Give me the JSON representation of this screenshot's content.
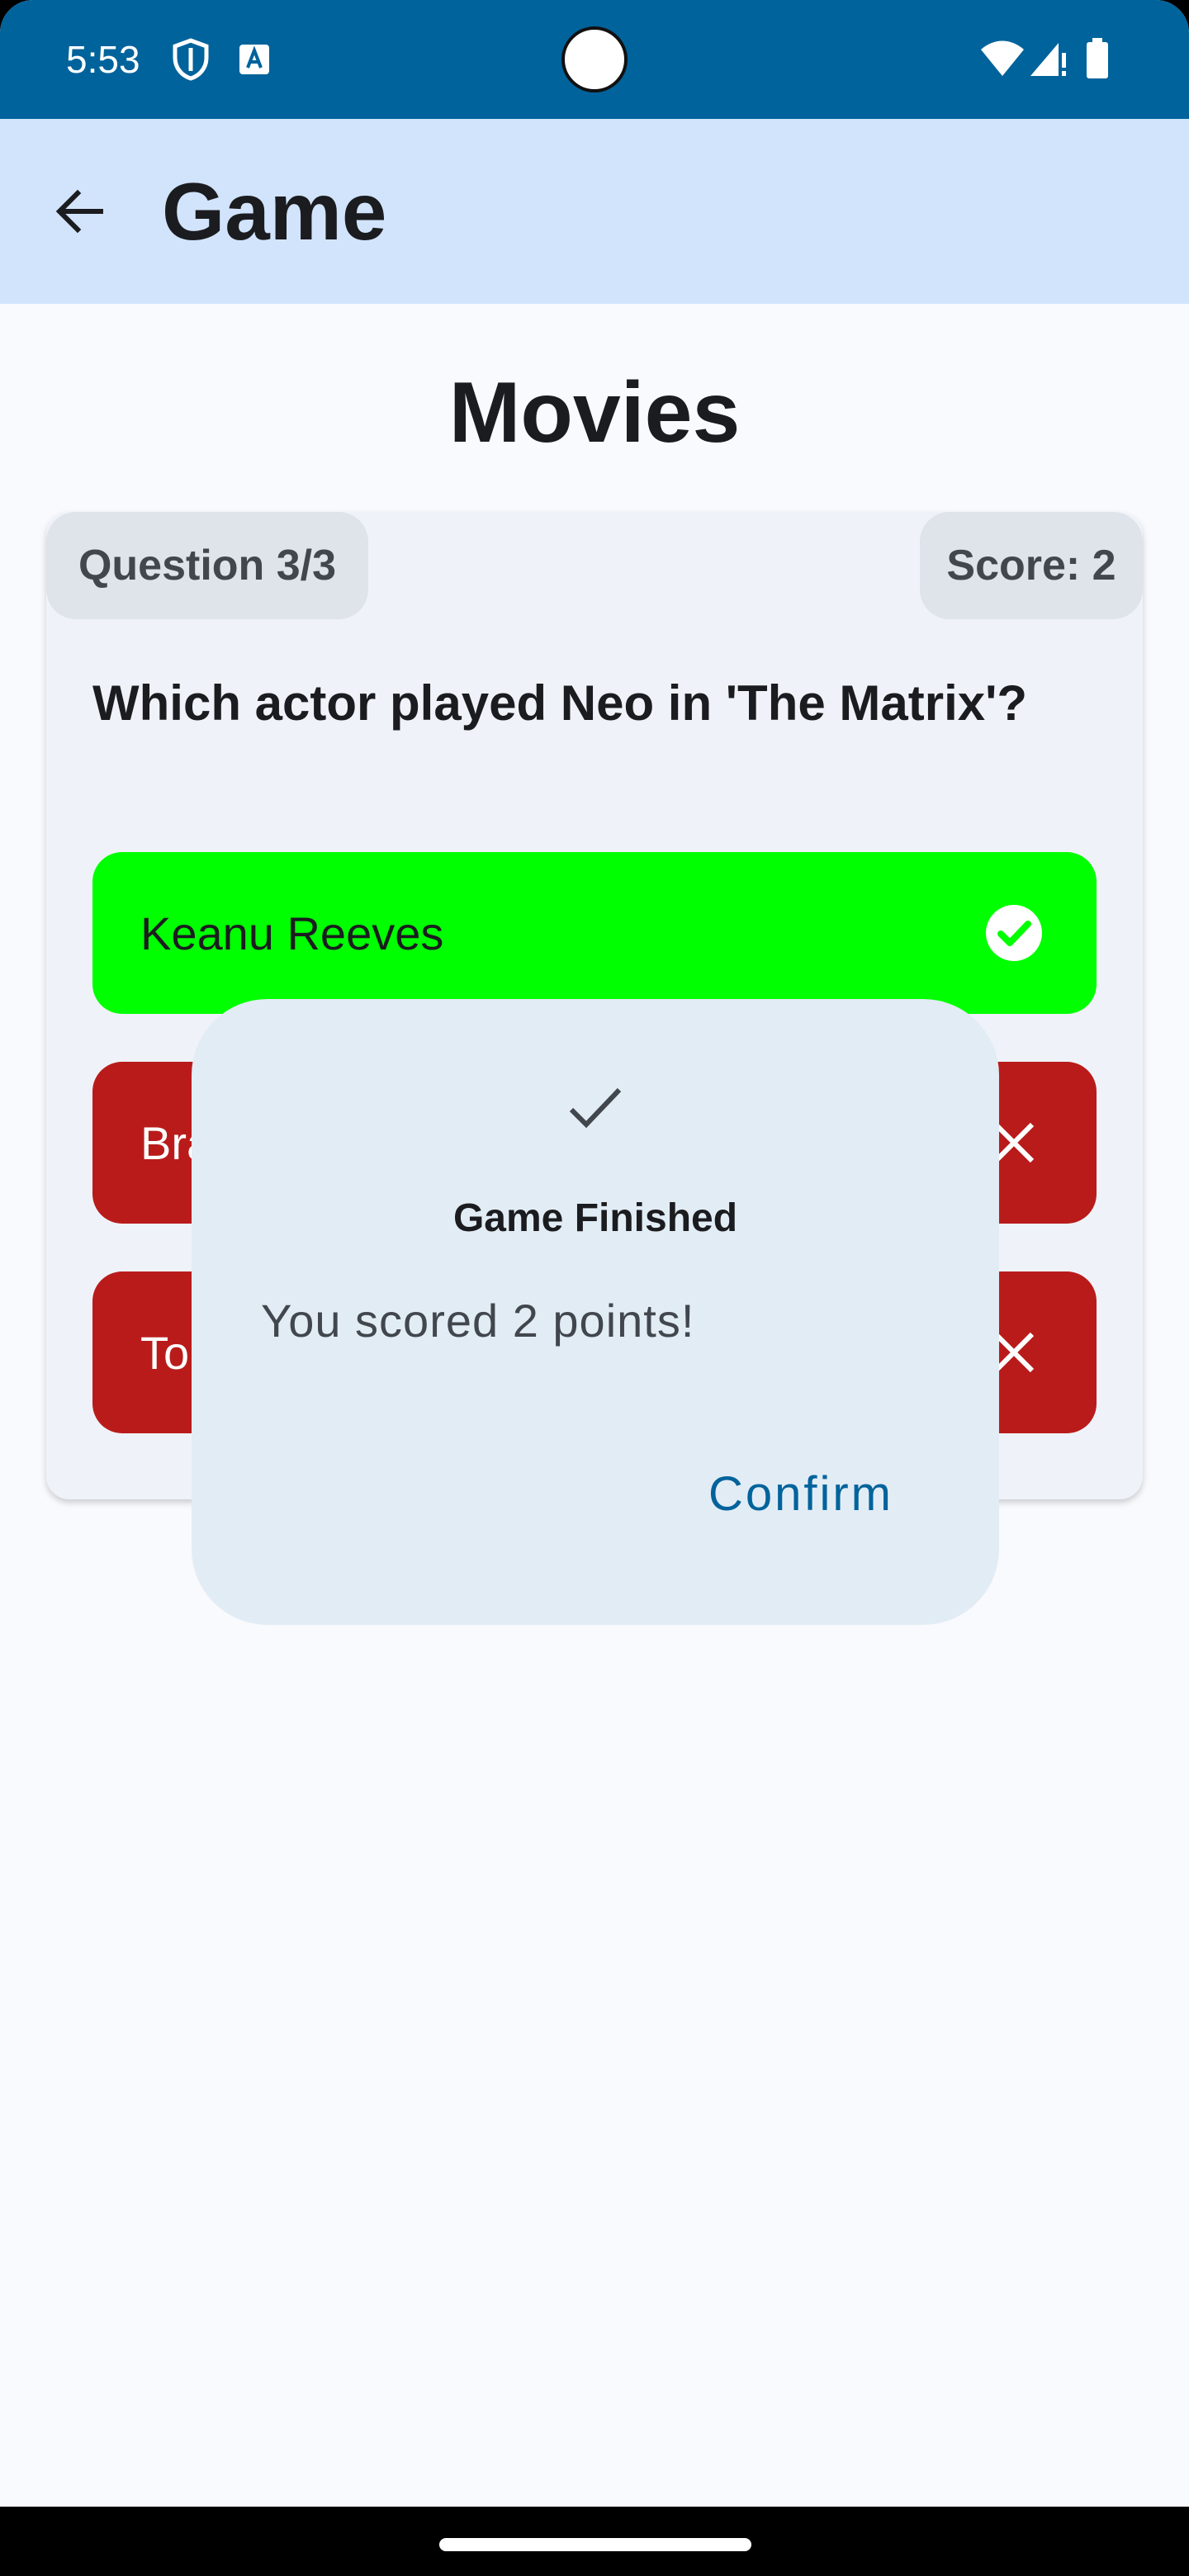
{
  "status_bar": {
    "time": "5:53",
    "icons": [
      "shield-icon",
      "keyboard-a-icon",
      "wifi-icon",
      "signal-icon",
      "battery-icon"
    ]
  },
  "app_bar": {
    "title": "Game",
    "back_icon": "arrow-back-icon"
  },
  "game": {
    "category": "Movies",
    "question_counter": "Question 3/3",
    "score": "Score: 2",
    "question": "Which actor played Neo in 'The Matrix'?",
    "answers": [
      {
        "label": "Keanu Reeves",
        "state": "correct",
        "icon": "check-circle-icon"
      },
      {
        "label": "Brad Pitt",
        "state": "wrong",
        "icon": "close-icon"
      },
      {
        "label": "Tom Cruise",
        "state": "wrong",
        "icon": "close-icon"
      }
    ],
    "visible_answer_prefixes": [
      "Bra",
      "To"
    ]
  },
  "dialog": {
    "icon": "check-icon",
    "title": "Game Finished",
    "body": "You scored 2 points!",
    "confirm_label": "Confirm"
  },
  "colors": {
    "status_bar": "#00639b",
    "app_bar": "#d1e4fc",
    "correct": "#00ff00",
    "wrong": "#b91b1b",
    "dialog_bg": "#e2ecf5",
    "accent": "#00639b"
  }
}
